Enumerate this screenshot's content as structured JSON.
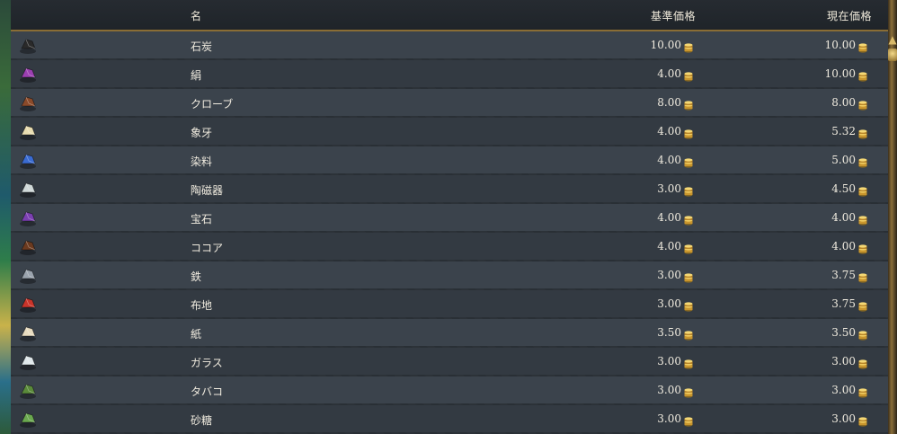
{
  "header": {
    "name_label": "名",
    "base_price_label": "基準価格",
    "current_price_label": "現在価格"
  },
  "goods": [
    {
      "name": "石炭",
      "base": "10.00",
      "current": "10.00",
      "icon": "coal-icon",
      "color": "#2a2a2a"
    },
    {
      "name": "絹",
      "base": "4.00",
      "current": "10.00",
      "icon": "silk-icon",
      "color": "#9b3fb0"
    },
    {
      "name": "クローブ",
      "base": "8.00",
      "current": "8.00",
      "icon": "cloves-icon",
      "color": "#8a4a2a"
    },
    {
      "name": "象牙",
      "base": "4.00",
      "current": "5.32",
      "icon": "ivory-icon",
      "color": "#e8dcb0"
    },
    {
      "name": "染料",
      "base": "4.00",
      "current": "5.00",
      "icon": "dye-icon",
      "color": "#3a6bd1"
    },
    {
      "name": "陶磁器",
      "base": "3.00",
      "current": "4.50",
      "icon": "porcelain-icon",
      "color": "#cfd8d8"
    },
    {
      "name": "宝石",
      "base": "4.00",
      "current": "4.00",
      "icon": "gems-icon",
      "color": "#7a3fb0"
    },
    {
      "name": "ココア",
      "base": "4.00",
      "current": "4.00",
      "icon": "cocoa-icon",
      "color": "#6b3a1f"
    },
    {
      "name": "鉄",
      "base": "3.00",
      "current": "3.75",
      "icon": "iron-icon",
      "color": "#9aa3ad"
    },
    {
      "name": "布地",
      "base": "3.00",
      "current": "3.75",
      "icon": "fabric-icon",
      "color": "#c9342a"
    },
    {
      "name": "紙",
      "base": "3.50",
      "current": "3.50",
      "icon": "paper-icon",
      "color": "#e8dcc0"
    },
    {
      "name": "ガラス",
      "base": "3.00",
      "current": "3.00",
      "icon": "glass-icon",
      "color": "#dfe7ea"
    },
    {
      "name": "タバコ",
      "base": "3.00",
      "current": "3.00",
      "icon": "tobacco-icon",
      "color": "#5a8a3a"
    },
    {
      "name": "砂糖",
      "base": "3.00",
      "current": "3.00",
      "icon": "sugar-icon",
      "color": "#6aa84f"
    }
  ],
  "coin_icon": "gold-coin-icon",
  "colors": {
    "header_border": "#8a6d35",
    "row_light": "#3b434c",
    "row_dark": "#333a42",
    "coin_gold": "#d9b04a"
  }
}
